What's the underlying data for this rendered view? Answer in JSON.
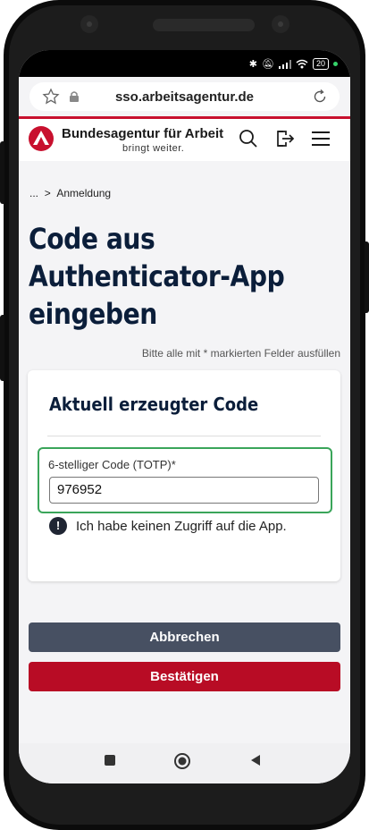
{
  "browser": {
    "url": "sso.arbeitsagentur.de"
  },
  "header": {
    "brand": "Bundesagentur für Arbeit",
    "tagline": "bringt weiter."
  },
  "breadcrumb": {
    "ellipsis": "...",
    "separator": ">",
    "current": "Anmeldung"
  },
  "page": {
    "title": "Code aus Authenticator-App eingeben",
    "required_note": "Bitte alle mit * markierten Felder ausfüllen"
  },
  "card": {
    "title": "Aktuell erzeugter Code",
    "field_label": "6-stelliger Code (TOTP)*",
    "field_value": "976952",
    "no_access_link": "Ich habe keinen Zugriff auf die App."
  },
  "buttons": {
    "cancel": "Abbrechen",
    "confirm": "Bestätigen"
  },
  "status": {
    "battery": "20"
  },
  "colors": {
    "brand_red": "#c8102e",
    "title_navy": "#0b1e3a",
    "cancel_gray": "#475062",
    "confirm_red": "#b80c25",
    "focus_green": "#3aa55a"
  },
  "icons": [
    "star-icon",
    "lock-icon",
    "reload-icon",
    "search-icon",
    "logout-icon",
    "menu-icon",
    "info-icon",
    "recents-icon",
    "home-icon",
    "back-icon"
  ]
}
